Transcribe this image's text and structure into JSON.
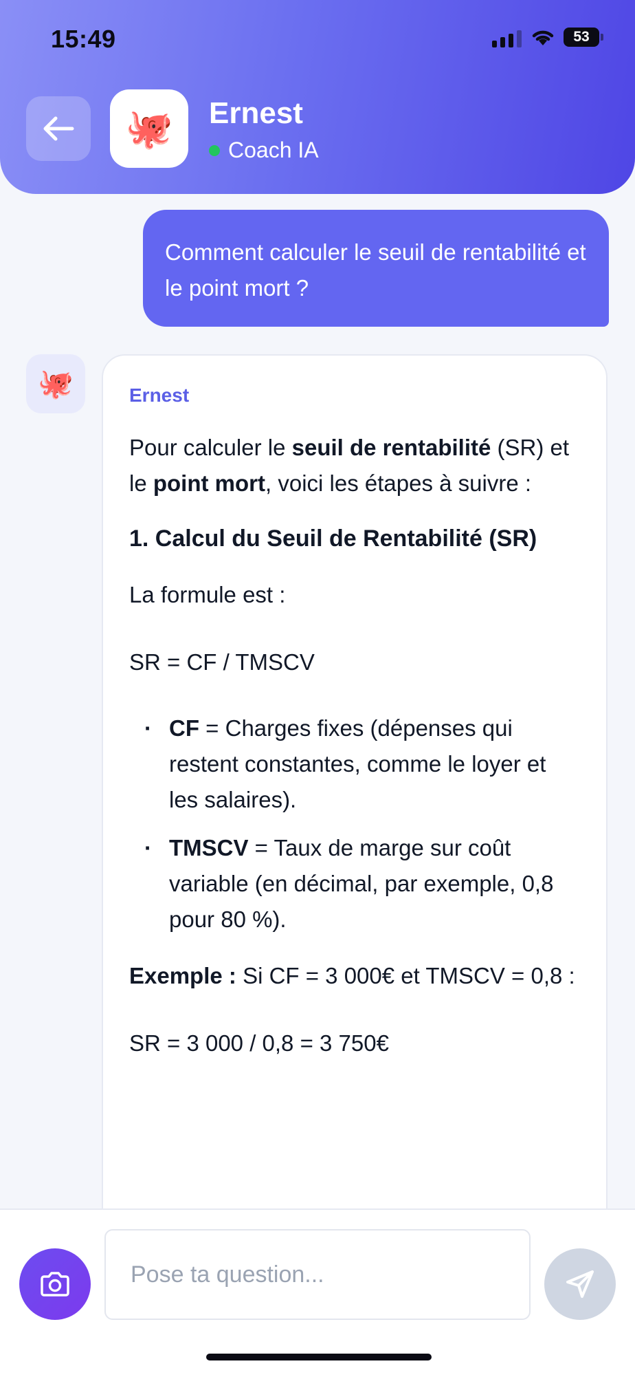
{
  "status_bar": {
    "time": "15:49",
    "battery": "53"
  },
  "header": {
    "bot_avatar_emoji": "🐙",
    "bot_name": "Ernest",
    "status_label": "Coach IA",
    "status_color": "#22c55e"
  },
  "user_message": {
    "text": "Comment calculer le seuil de rentabilité et le point mort ?"
  },
  "bot_message": {
    "avatar_emoji": "🐙",
    "sender": "Ernest",
    "intro": {
      "t1": "Pour calculer le ",
      "b1": "seuil de rentabilité",
      "t2": " (SR) et le ",
      "b2": "point mort",
      "t3": ", voici les étapes à suivre :"
    },
    "heading": "1. Calcul du Seuil de Rentabilité (SR)",
    "formula_intro": "La formule est :",
    "formula": "SR = CF / TMSCV",
    "bullets": [
      {
        "term": "CF",
        "text": " = Charges fixes (dépenses qui restent constantes, comme le loyer et les salaires)."
      },
      {
        "term": "TMSCV",
        "text": " = Taux de marge sur coût variable (en décimal, par exemple, 0,8 pour 80 %)."
      }
    ],
    "example_label": "Exemple :",
    "example_text": " Si CF = 3 000€ et TMSCV = 0,8 :",
    "example_result": "SR = 3 000 / 0,8 = 3 750€"
  },
  "composer": {
    "placeholder": "Pose ta question..."
  },
  "colors": {
    "accent": "#6366f1",
    "header_gradient_end": "#4f46e5",
    "camera_button": "#7c3aed",
    "send_button_disabled": "#cfd6e2"
  }
}
